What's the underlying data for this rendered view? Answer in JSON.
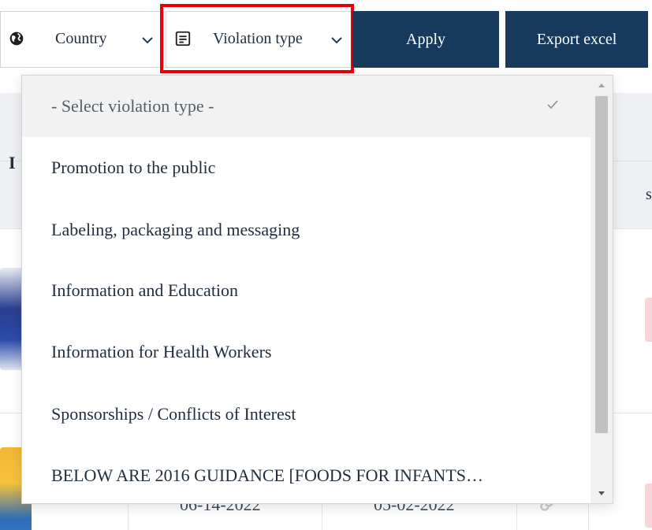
{
  "filters": {
    "country": {
      "label": "Country",
      "icon": "globe-icon"
    },
    "violation_type": {
      "label": "Violation type",
      "icon": "document-icon"
    }
  },
  "buttons": {
    "apply": "Apply",
    "export": "Export excel"
  },
  "colors": {
    "button_bg": "#173a5c",
    "highlight": "#e8000b",
    "selected_row": "#f2f2f2"
  },
  "table": {
    "header_fragment": "I",
    "header_fragment_right": "s",
    "row2_dates": [
      "06-14-2022",
      "05-02-2022"
    ]
  },
  "dropdown": {
    "options": [
      {
        "label": "- Select violation type -",
        "selected": true
      },
      {
        "label": "Promotion to the public",
        "selected": false
      },
      {
        "label": "Labeling, packaging and messaging",
        "selected": false
      },
      {
        "label": "Information and Education",
        "selected": false
      },
      {
        "label": "Information for Health Workers",
        "selected": false
      },
      {
        "label": "Sponsorships / Conflicts of Interest",
        "selected": false
      },
      {
        "label": "BELOW ARE 2016 GUIDANCE [FOODS FOR INFANTS…",
        "selected": false
      }
    ]
  }
}
